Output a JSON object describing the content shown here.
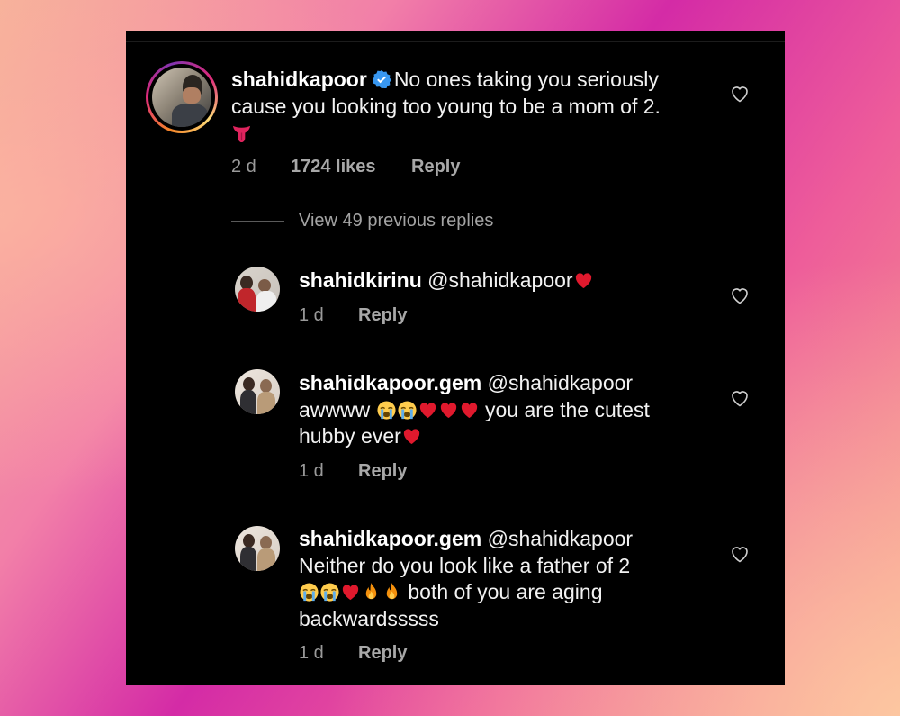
{
  "main_comment": {
    "username": "shahidkapoor",
    "text_line1": "No ones taking you seriously",
    "text_line2": "cause you looking too young to be a mom of 2.",
    "age": "2 d",
    "likes": "1724 likes",
    "reply_label": "Reply"
  },
  "view_replies": "View 49 previous replies",
  "replies": [
    {
      "username": "shahidkirinu",
      "mention": "@shahidkapoor",
      "age": "1 d",
      "reply_label": "Reply"
    },
    {
      "username": "shahidkapoor.gem",
      "mention": "@shahidkapoor",
      "line2_start": "awwww",
      "line2_end": "you are the cutest",
      "line3": "hubby ever",
      "age": "1 d",
      "reply_label": "Reply"
    },
    {
      "username": "shahidkapoor.gem",
      "mention": "@shahidkapoor",
      "line2": "Neither do you look like a father of 2",
      "line3_end": "both of you are aging",
      "line4": "backwardsssss",
      "age": "1 d",
      "reply_label": "Reply"
    }
  ],
  "colors": {
    "background": "#000000",
    "text": "#f2f2f2",
    "muted": "#9a9a9a",
    "verified": "#3897f0",
    "heart_emoji": "#e0245e"
  },
  "icons": [
    "heart-outline-icon",
    "verified-badge-icon",
    "tongue-emoji",
    "crying-emoji",
    "red-heart-emoji",
    "fire-emoji"
  ]
}
